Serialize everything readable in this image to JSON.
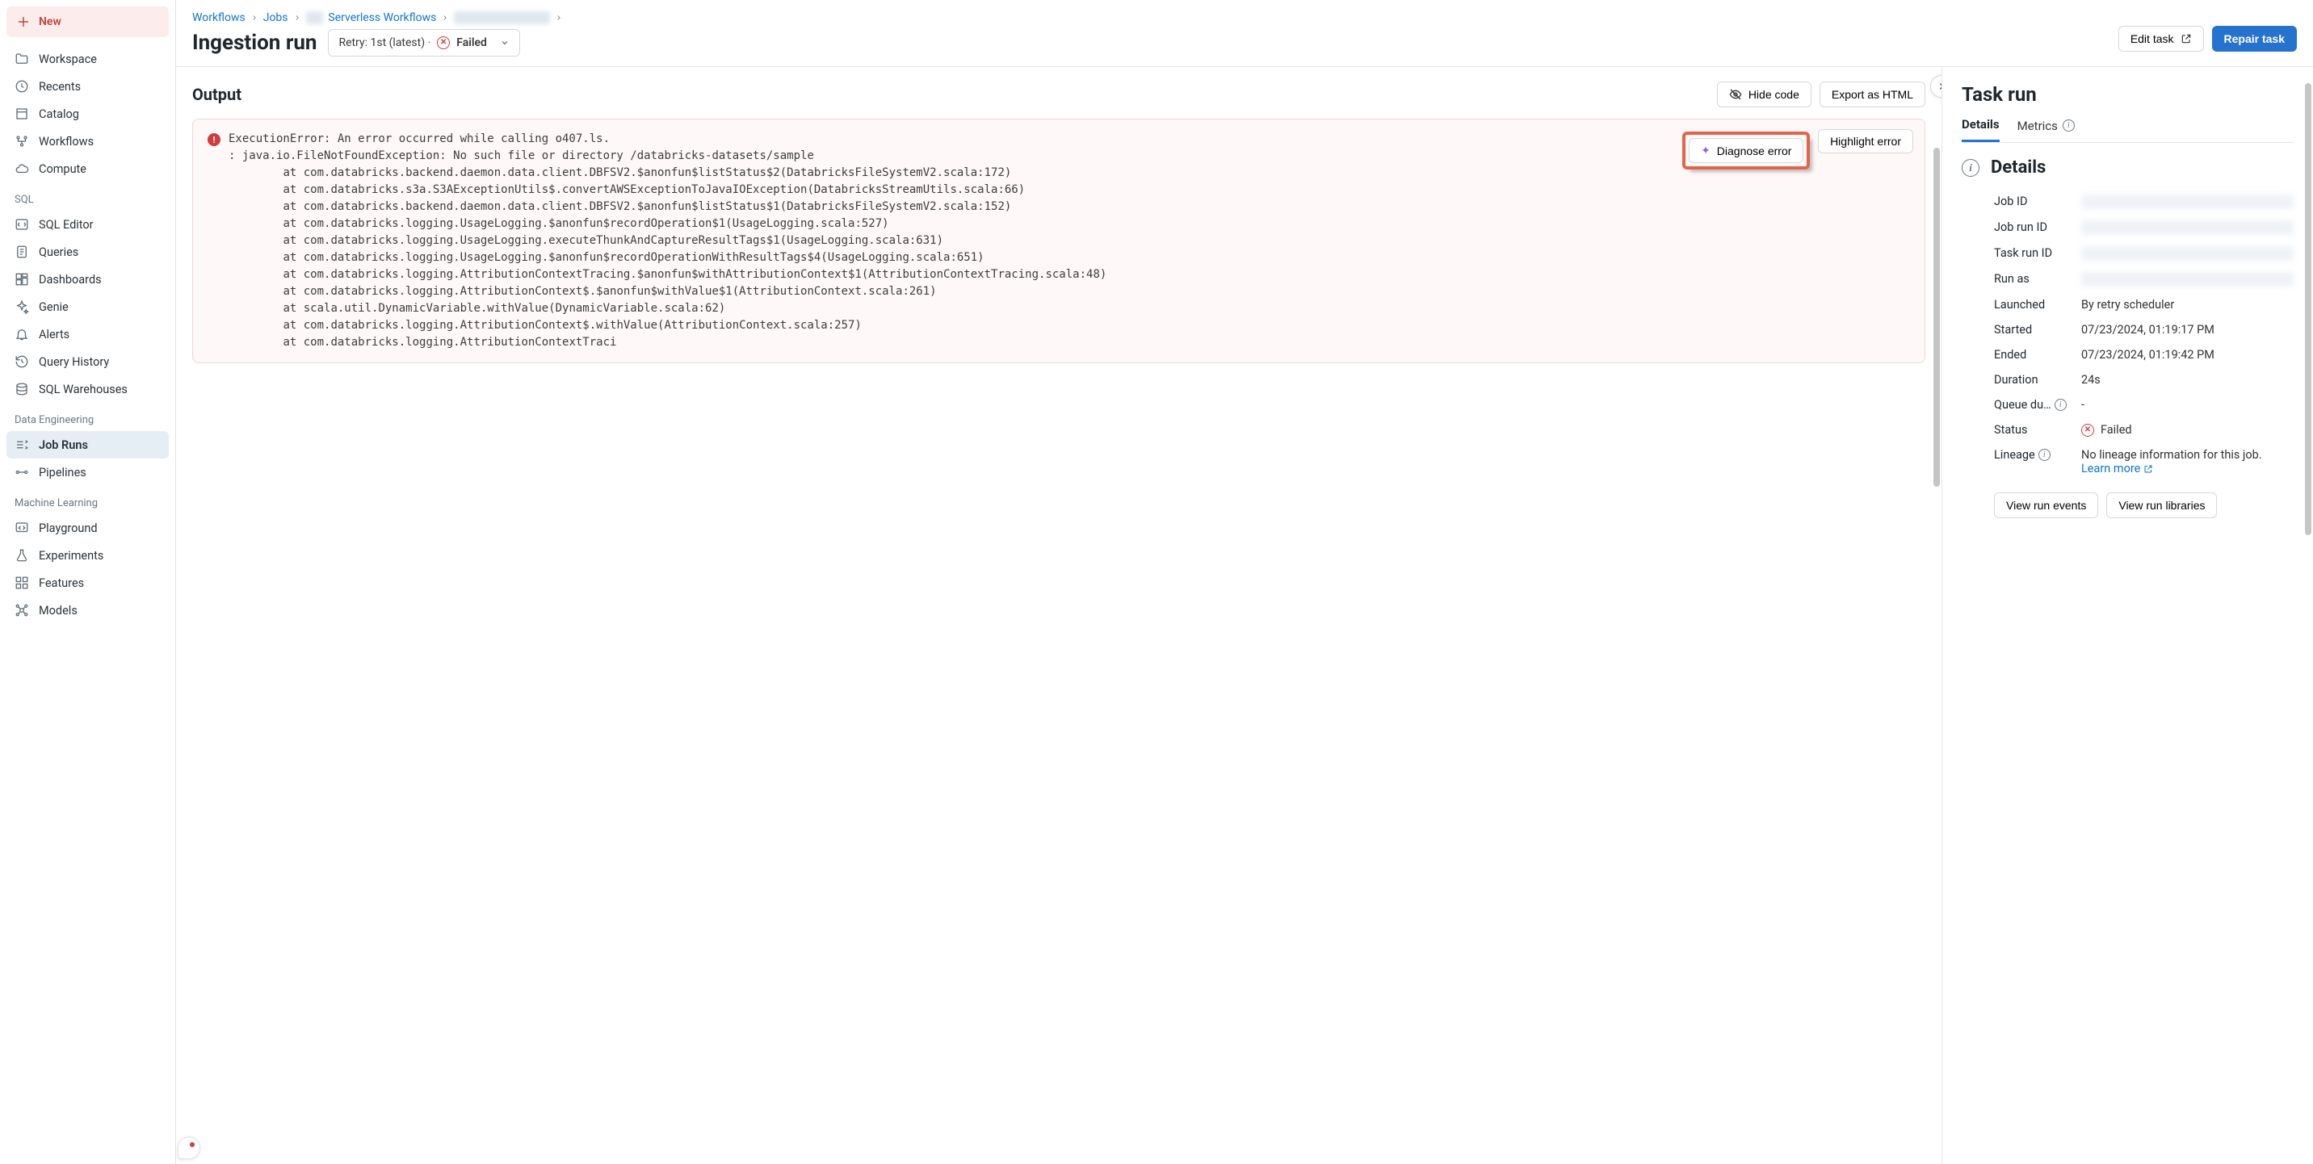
{
  "sidebar": {
    "new_label": "New",
    "primary": [
      {
        "label": "Workspace",
        "icon": "folder"
      },
      {
        "label": "Recents",
        "icon": "clock"
      },
      {
        "label": "Catalog",
        "icon": "catalog"
      },
      {
        "label": "Workflows",
        "icon": "workflow"
      },
      {
        "label": "Compute",
        "icon": "cloud"
      }
    ],
    "sql_label": "SQL",
    "sql": [
      {
        "label": "SQL Editor",
        "icon": "sql"
      },
      {
        "label": "Queries",
        "icon": "doc"
      },
      {
        "label": "Dashboards",
        "icon": "dash"
      },
      {
        "label": "Genie",
        "icon": "genie"
      },
      {
        "label": "Alerts",
        "icon": "bell"
      },
      {
        "label": "Query History",
        "icon": "history"
      },
      {
        "label": "SQL Warehouses",
        "icon": "warehouse"
      }
    ],
    "de_label": "Data Engineering",
    "de": [
      {
        "label": "Job Runs",
        "icon": "runs",
        "active": true
      },
      {
        "label": "Pipelines",
        "icon": "pipe"
      }
    ],
    "ml_label": "Machine Learning",
    "ml": [
      {
        "label": "Playground",
        "icon": "play"
      },
      {
        "label": "Experiments",
        "icon": "flask"
      },
      {
        "label": "Features",
        "icon": "feat"
      },
      {
        "label": "Models",
        "icon": "model"
      }
    ]
  },
  "breadcrumb": {
    "items": [
      "Workflows",
      "Jobs",
      "Serverless Workflows"
    ]
  },
  "page": {
    "title": "Ingestion run",
    "retry_prefix": "Retry: 1st (latest) ·",
    "retry_status": "Failed"
  },
  "actions": {
    "edit_task": "Edit task",
    "repair_task": "Repair task",
    "hide_code": "Hide code",
    "export_html": "Export as HTML",
    "diagnose": "Diagnose error",
    "highlight": "Highlight error"
  },
  "output": {
    "heading": "Output",
    "stack": "ExecutionError: An error occurred while calling o407.ls.\n: java.io.FileNotFoundException: No such file or directory /databricks-datasets/sample\n        at com.databricks.backend.daemon.data.client.DBFSV2.$anonfun$listStatus$2(DatabricksFileSystemV2.scala:172)\n        at com.databricks.s3a.S3AExceptionUtils$.convertAWSExceptionToJavaIOException(DatabricksStreamUtils.scala:66)\n        at com.databricks.backend.daemon.data.client.DBFSV2.$anonfun$listStatus$1(DatabricksFileSystemV2.scala:152)\n        at com.databricks.logging.UsageLogging.$anonfun$recordOperation$1(UsageLogging.scala:527)\n        at com.databricks.logging.UsageLogging.executeThunkAndCaptureResultTags$1(UsageLogging.scala:631)\n        at com.databricks.logging.UsageLogging.$anonfun$recordOperationWithResultTags$4(UsageLogging.scala:651)\n        at com.databricks.logging.AttributionContextTracing.$anonfun$withAttributionContext$1(AttributionContextTracing.scala:48)\n        at com.databricks.logging.AttributionContext$.$anonfun$withValue$1(AttributionContext.scala:261)\n        at scala.util.DynamicVariable.withValue(DynamicVariable.scala:62)\n        at com.databricks.logging.AttributionContext$.withValue(AttributionContext.scala:257)\n        at com.databricks.logging.AttributionContextTraci"
  },
  "taskrun": {
    "heading": "Task run",
    "tabs": {
      "details": "Details",
      "metrics": "Metrics"
    },
    "details_heading": "Details",
    "rows": {
      "job_id": {
        "label": "Job ID"
      },
      "job_run_id": {
        "label": "Job run ID"
      },
      "task_run_id": {
        "label": "Task run ID"
      },
      "run_as": {
        "label": "Run as"
      },
      "launched": {
        "label": "Launched",
        "value": "By retry scheduler"
      },
      "started": {
        "label": "Started",
        "value": "07/23/2024, 01:19:17 PM"
      },
      "ended": {
        "label": "Ended",
        "value": "07/23/2024, 01:19:42 PM"
      },
      "duration": {
        "label": "Duration",
        "value": "24s"
      },
      "queue": {
        "label": "Queue du…",
        "value": "-"
      },
      "status": {
        "label": "Status",
        "value": "Failed"
      },
      "lineage": {
        "label": "Lineage",
        "value": "No lineage information for this job.",
        "learn_more": "Learn more"
      }
    },
    "buttons": {
      "events": "View run events",
      "libraries": "View run libraries"
    }
  }
}
